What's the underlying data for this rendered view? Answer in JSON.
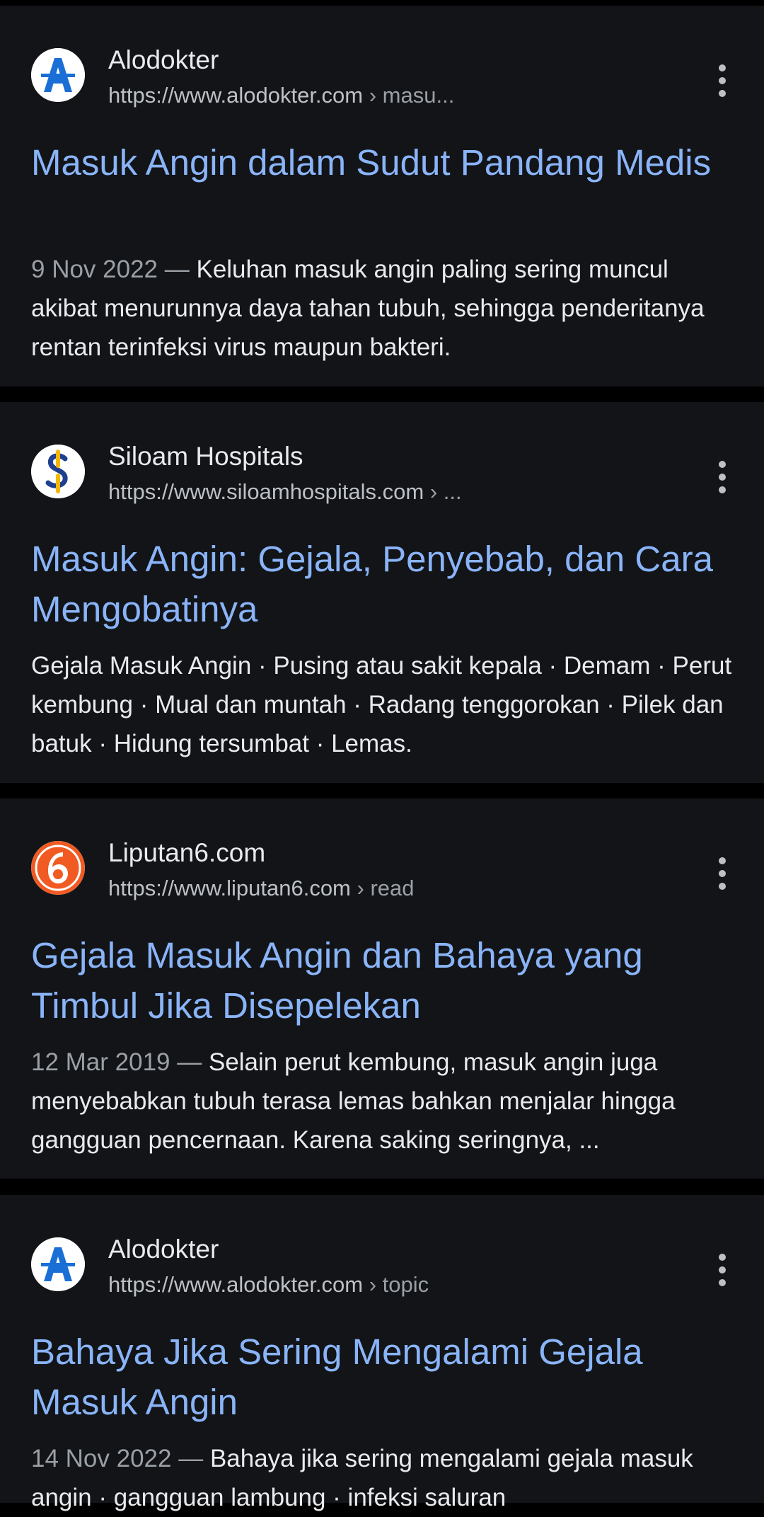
{
  "results": [
    {
      "site_name": "Alodokter",
      "url": "https://www.alodokter.com",
      "breadcrumb": " › masu...",
      "favicon": "alodokter-logo",
      "title": "Masuk Angin dalam Sudut Pandang Medis",
      "date": "9 Nov 2022 — ",
      "snippet": "Keluhan masuk angin paling sering muncul akibat menurunnya daya tahan tubuh, sehingga penderitanya rentan terinfeksi virus maupun bakteri."
    },
    {
      "site_name": "Siloam Hospitals",
      "url": "https://www.siloamhospitals.com",
      "breadcrumb": " › ...",
      "favicon": "siloam-logo",
      "title": "Masuk Angin: Gejala, Penyebab, dan Cara Mengobatinya",
      "date": "",
      "snippet": "Gejala Masuk Angin · Pusing atau sakit kepala · Demam · Perut kembung · Mual dan muntah · Radang tenggorokan · Pilek dan batuk · Hidung tersumbat · Lemas."
    },
    {
      "site_name": "Liputan6.com",
      "url": "https://www.liputan6.com",
      "breadcrumb": " › read",
      "favicon": "liputan6-logo",
      "title": "Gejala Masuk Angin dan Bahaya yang Timbul Jika Disepelekan",
      "date": "12 Mar 2019 — ",
      "snippet": "Selain perut kembung, masuk angin juga menyebabkan tubuh terasa lemas bahkan menjalar hingga gangguan pencernaan. Karena saking seringnya, ..."
    },
    {
      "site_name": "Alodokter",
      "url": "https://www.alodokter.com",
      "breadcrumb": " › topic",
      "favicon": "alodokter-logo",
      "title": "Bahaya Jika Sering Mengalami Gejala Masuk Angin",
      "date": "14 Nov 2022 — ",
      "snippet": "Bahaya jika sering mengalami gejala masuk angin · gangguan lambung · infeksi saluran"
    }
  ],
  "colors": {
    "page_background": "#000000",
    "card_background": "#121418",
    "title_link": "#8ab4f8",
    "text_primary": "#e8eaed",
    "text_secondary": "#9aa0a6",
    "alodokter_blue": "#1a6fd6",
    "siloam_blue": "#1f3f8f",
    "siloam_yellow": "#f5b700",
    "liputan6_orange": "#f15a22"
  },
  "icons": {
    "menu": "more-vert-icon"
  }
}
